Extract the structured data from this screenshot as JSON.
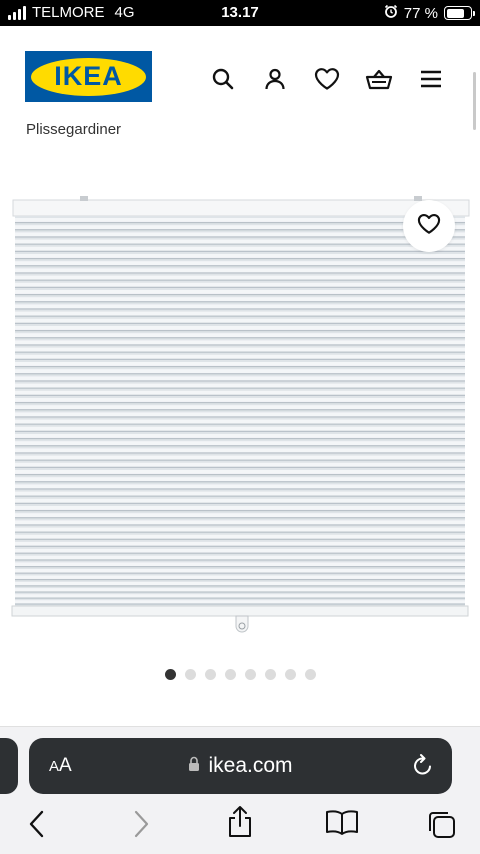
{
  "status_bar": {
    "carrier": "TELMORE",
    "network": "4G",
    "time": "13.17",
    "battery_percent_label": "77 %",
    "battery_level": 0.77,
    "icons": [
      "signal-icon",
      "alarm-icon",
      "battery-icon"
    ]
  },
  "header": {
    "logo_text": "IKEA",
    "icons": [
      "search-icon",
      "account-icon",
      "heart-icon",
      "basket-icon",
      "menu-icon"
    ]
  },
  "breadcrumb": "Plissegardiner",
  "gallery": {
    "image": "pleated-blind-image",
    "total_images": 8,
    "active_index": 0,
    "favorite_icon": "heart-icon"
  },
  "safari": {
    "text_size_label": "AA",
    "url": "ikea.com",
    "icons": [
      "lock-icon",
      "reload-icon",
      "back-icon",
      "forward-icon",
      "share-icon",
      "bookmarks-icon",
      "tabs-icon"
    ]
  },
  "colors": {
    "ikea_blue": "#0058a3",
    "ikea_yellow": "#ffdb00",
    "url_bar": "#2d3033"
  }
}
